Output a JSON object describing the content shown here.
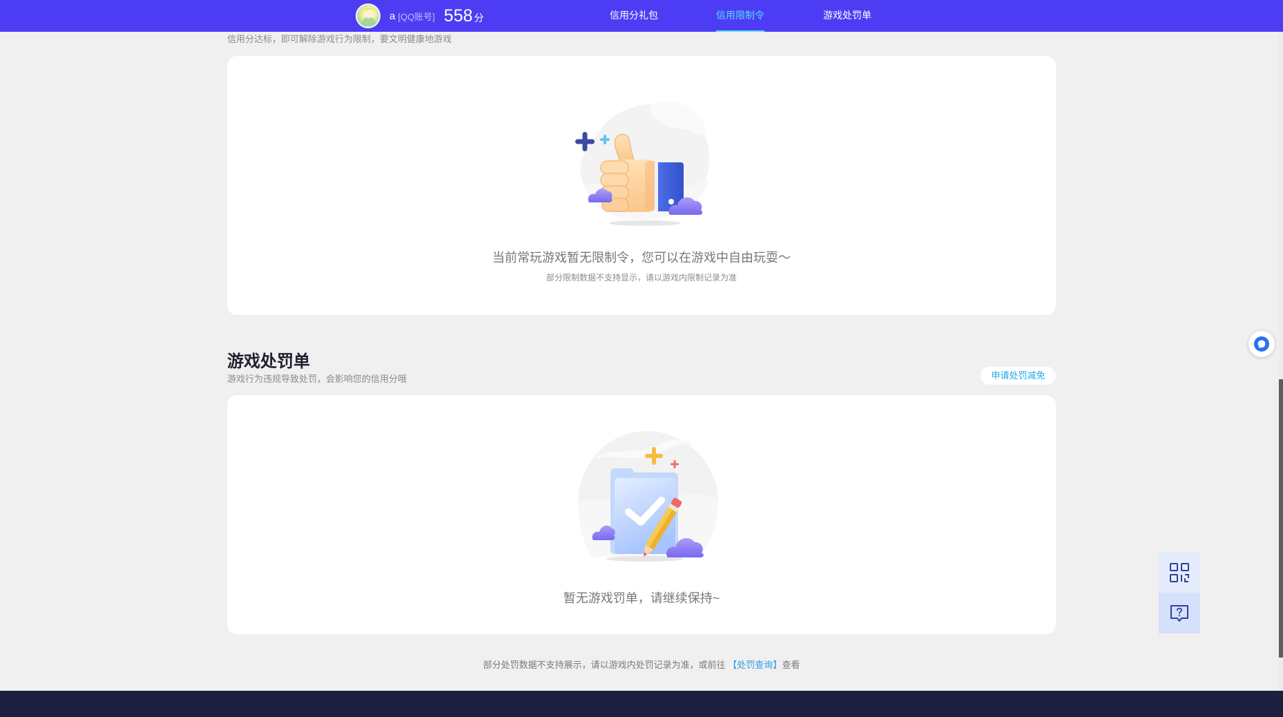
{
  "colors": {
    "nav_bg": "#4c3df4",
    "nav_active": "#5ad8ff",
    "page_bg": "#f0f0f0",
    "footer_bg": "#1c1f3f",
    "link": "#2f9be6",
    "accent": "#1aa8ee"
  },
  "nav": {
    "avatar_icon": "avatar",
    "username": "a",
    "account_type": "[QQ账号]",
    "score": "558",
    "score_unit": "分",
    "links": [
      {
        "label": "信用分礼包",
        "active": false
      },
      {
        "label": "信用限制令",
        "active": true
      },
      {
        "label": "游戏处罚单",
        "active": false
      }
    ]
  },
  "restriction": {
    "subtitle": "信用分达标，即可解除游戏行为限制，要文明健康地游戏",
    "illustration_icon": "thumbs-up-illustration",
    "empty_message": "当前常玩游戏暂无限制令，您可以在游戏中自由玩耍～",
    "note": "部分限制数据不支持显示，请以游戏内限制记录为准"
  },
  "penalty": {
    "title": "游戏处罚单",
    "subtitle": "游戏行为违规导致处罚，会影响您的信用分哦",
    "appeal_button": "申请处罚减免",
    "illustration_icon": "clipboard-check-illustration",
    "empty_message": "暂无游戏罚单，请继续保持~"
  },
  "footer_note": {
    "prefix": "部分处罚数据不支持展示，请以游戏内处罚记录为准，或前往 ",
    "link": "【处罚查询】",
    "suffix": "查看"
  },
  "floating_tools": {
    "chat_icon": "chat-bubble-icon",
    "items": [
      {
        "icon": "qr-code-icon"
      },
      {
        "icon": "help-chat-icon"
      }
    ]
  }
}
